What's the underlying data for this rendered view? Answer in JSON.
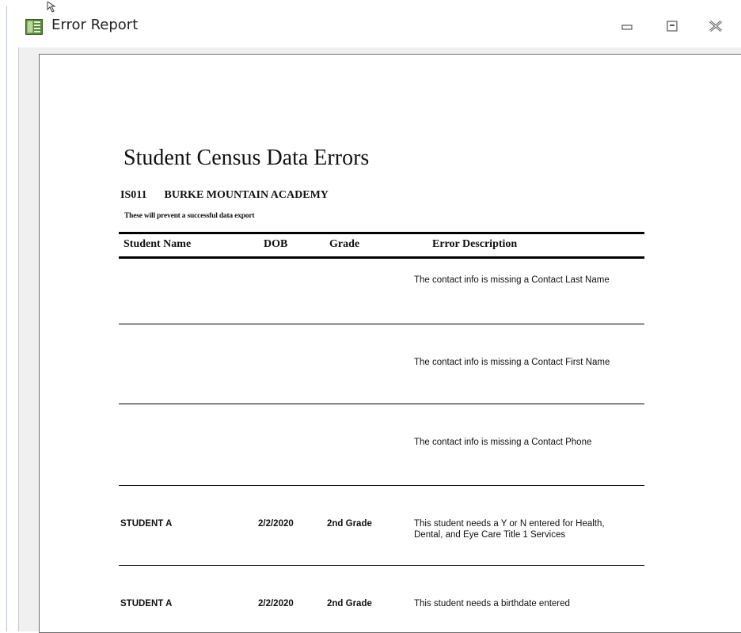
{
  "window": {
    "title": "Error Report",
    "icon": "access-report-icon",
    "buttons": {
      "minimize": "minimize-icon",
      "restore": "restore-icon",
      "close": "close-icon"
    }
  },
  "report": {
    "title": "Student Census Data Errors",
    "school_code": "IS011",
    "school_name": "BURKE MOUNTAIN ACADEMY",
    "subtitle": "These will prevent a successful data export",
    "columns": {
      "student_name": "Student Name",
      "dob": "DOB",
      "grade": "Grade",
      "error_description": "Error Description"
    },
    "rows": [
      {
        "student": "",
        "dob": "",
        "grade": "",
        "error": "The contact info is missing a Contact Last Name"
      },
      {
        "student": "",
        "dob": "",
        "grade": "",
        "error": "The contact info is missing a Contact First Name"
      },
      {
        "student": "",
        "dob": "",
        "grade": "",
        "error": "The contact info is missing a Contact Phone"
      },
      {
        "student": "STUDENT A",
        "dob": "2/2/2020",
        "grade": "2nd Grade",
        "error": "This student needs a Y or N entered for Health, Dental, and Eye Care Title 1 Services"
      },
      {
        "student": "STUDENT A",
        "dob": "2/2/2020",
        "grade": "2nd Grade",
        "error": "This student needs a birthdate entered"
      }
    ]
  }
}
